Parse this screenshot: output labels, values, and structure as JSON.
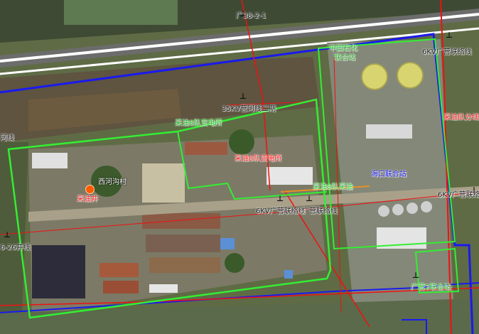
{
  "map": {
    "colors": {
      "station_boundary": "#33ee33",
      "network_boundary": "#1a1aee",
      "power_line": "#ee1111",
      "label_black": "#111111",
      "label_green": "#22dd22",
      "label_red": "#ff2020",
      "label_blue": "#1010dd",
      "label_white": "#ffffff",
      "well_marker": "#ff5a00"
    },
    "labels": {
      "line_guang_38_2_1": "广38-2-1",
      "station_top_name_1": "中国石化",
      "station_top_name_2": "联合站",
      "line_6kv_guang_link": "6KV广营联络线",
      "line_35kv": "35KV营河线二期",
      "substation_green": "采油8队变电所",
      "substation_red": "采油8队变电所",
      "station_blue": "海口联合站",
      "line_right_red": "采油队分线",
      "line_left_top": "河线",
      "village": "西河沟村",
      "well_red": "采油井",
      "line_6kv_mid_right": "6KV广营联络线",
      "line_6kv_lower": "6KV广营联络线",
      "line_6kv_lower_overlap": "广营联络线",
      "line_orange_mid": "采油8队采油",
      "line_left_mid": "6-26井线",
      "station_bottom_right": "广营2联合站"
    },
    "icons": [
      "power-pole-icon",
      "well-marker-icon"
    ]
  }
}
